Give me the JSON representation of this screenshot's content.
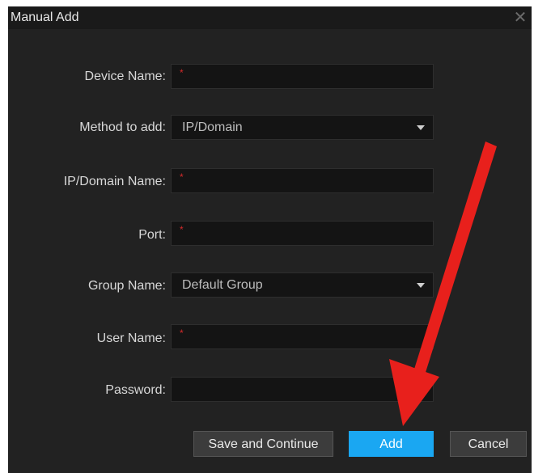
{
  "dialog": {
    "title": "Manual Add",
    "close_glyph": "✕"
  },
  "form": {
    "device_name": {
      "label": "Device Name:",
      "value": "",
      "required_mark": "*"
    },
    "method_to_add": {
      "label": "Method to add:",
      "value": "IP/Domain"
    },
    "ip_domain_name": {
      "label": "IP/Domain Name:",
      "value": "",
      "required_mark": "*"
    },
    "port": {
      "label": "Port:",
      "value": "",
      "required_mark": "*"
    },
    "group_name": {
      "label": "Group Name:",
      "value": "Default Group"
    },
    "user_name": {
      "label": "User Name:",
      "value": "",
      "required_mark": "*"
    },
    "password": {
      "label": "Password:",
      "value": ""
    }
  },
  "buttons": {
    "save_continue": "Save and Continue",
    "add": "Add",
    "cancel": "Cancel"
  },
  "colors": {
    "dialog_bg": "#222222",
    "field_bg": "#141414",
    "required": "#d42a2a",
    "accent": "#1aa7f2",
    "annotation_arrow": "#e8201c"
  },
  "icons": {
    "close": "close-icon",
    "dropdown": "chevron-down-icon",
    "annotation": "red-arrow-annotation"
  }
}
